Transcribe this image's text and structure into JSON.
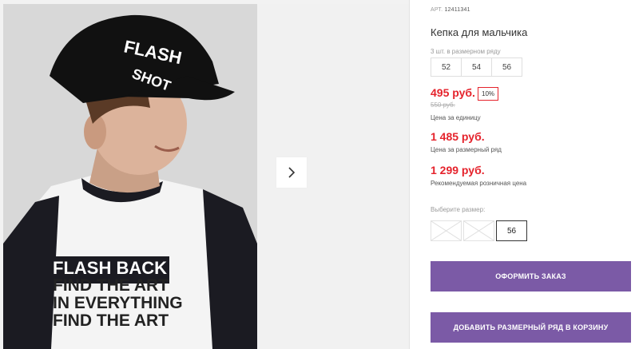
{
  "gallery": {
    "next_icon": "chevron-right-icon",
    "print_lines": [
      "FLASH BACK",
      "FIND THE ART",
      "IN EVERYTHING",
      "FIND THE ART"
    ]
  },
  "product": {
    "art_label": "АРТ.",
    "art_number": "12411341",
    "title": "Кепка для мальчика",
    "row_label": "3 шт. в размерном ряду",
    "row_sizes": [
      "52",
      "54",
      "56"
    ],
    "price": "495 руб.",
    "discount": "10%",
    "old_price": "550 руб.",
    "unit_caption": "Цена за единицу",
    "row_price": "1 485 руб.",
    "row_caption": "Цена за размерный ряд",
    "rec_price": "1 299 руб.",
    "rec_caption": "Рекомендуемая розничная цена",
    "choose_label": "Выберите размер:",
    "available_size": "56",
    "order_button": "ОФОРМИТЬ ЗАКАЗ",
    "cart_button": "ДОБАВИТЬ РАЗМЕРНЫЙ РЯД В КОРЗИНУ"
  },
  "colors": {
    "price_red": "#e5232c",
    "button_purple": "#7b5aa6"
  }
}
